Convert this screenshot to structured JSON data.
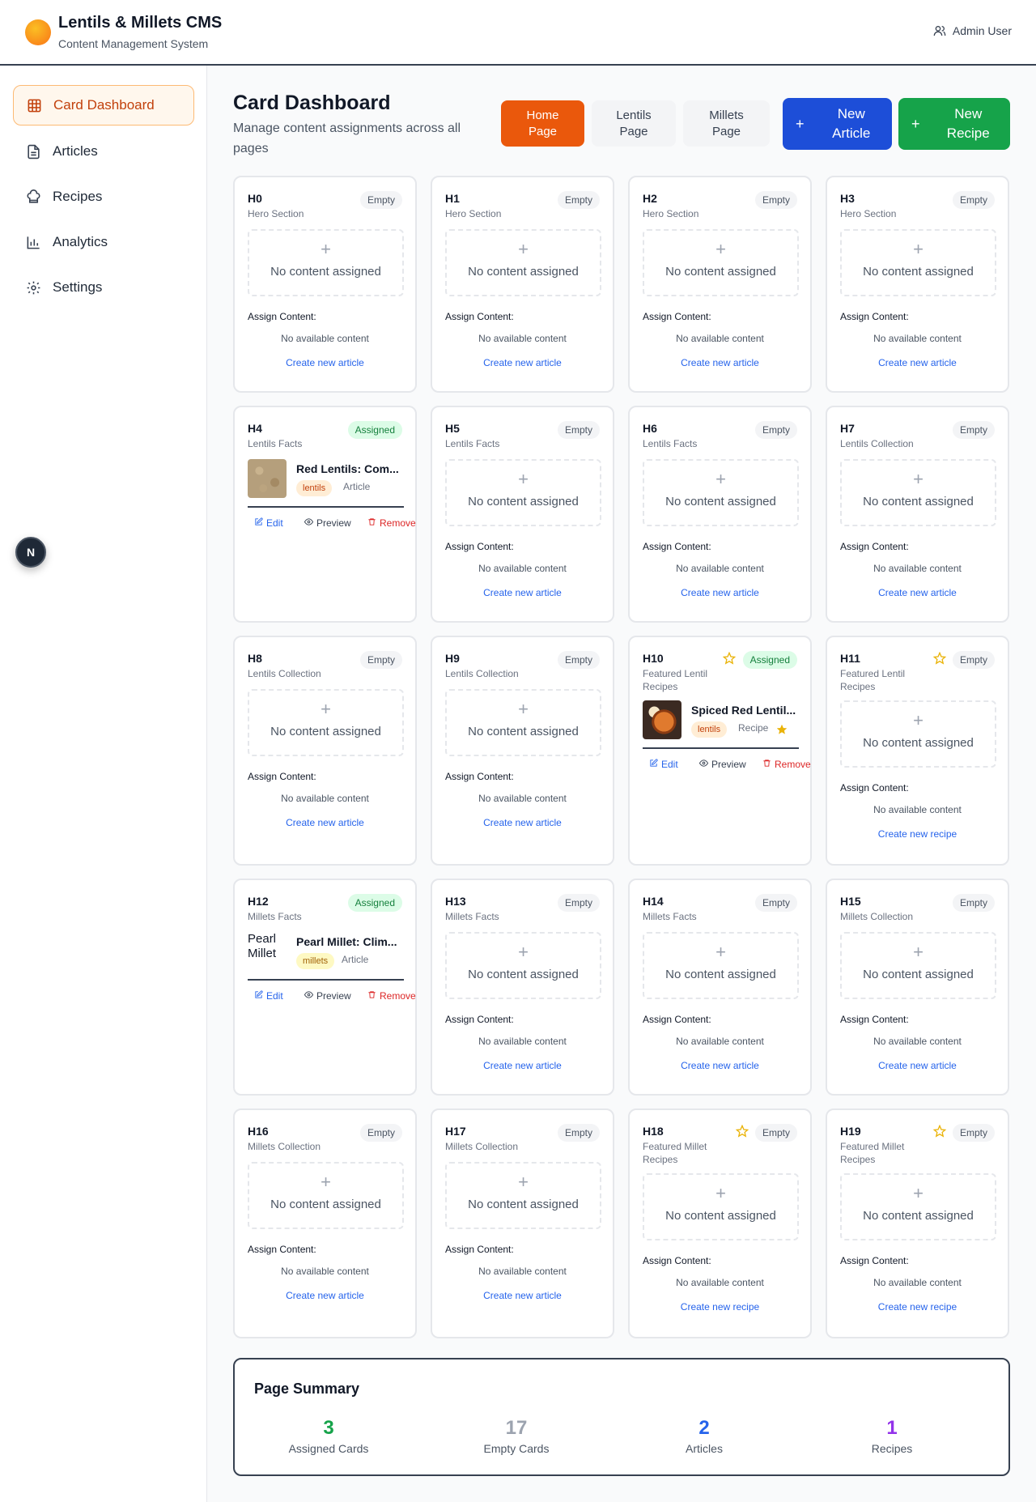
{
  "header": {
    "title": "Lentils & Millets CMS",
    "subtitle": "Content Management System",
    "user": "Admin User"
  },
  "sidebar": {
    "items": [
      {
        "label": "Card Dashboard",
        "icon": "grid-icon"
      },
      {
        "label": "Articles",
        "icon": "file-text-icon"
      },
      {
        "label": "Recipes",
        "icon": "chef-hat-icon"
      },
      {
        "label": "Analytics",
        "icon": "bar-chart-icon"
      },
      {
        "label": "Settings",
        "icon": "gear-icon"
      }
    ],
    "badge": "N"
  },
  "main": {
    "title": "Card Dashboard",
    "description": "Manage content assignments across all pages",
    "tabs": [
      {
        "label": "Home Page",
        "active": true
      },
      {
        "label": "Lentils Page",
        "active": false
      },
      {
        "label": "Millets Page",
        "active": false
      }
    ],
    "new_article": "New Article",
    "new_recipe": "New Recipe"
  },
  "common": {
    "empty_badge": "Empty",
    "assigned_badge": "Assigned",
    "dropzone_plus": "+",
    "no_content": "No content assigned",
    "assign_label": "Assign Content:",
    "no_available": "No available content",
    "edit": "Edit",
    "preview": "Preview",
    "remove": "Remove",
    "plus": "+"
  },
  "cards": [
    {
      "id": "H0",
      "type": "Hero Section",
      "status": "Empty",
      "featured": false,
      "create": "Create new article"
    },
    {
      "id": "H1",
      "type": "Hero Section",
      "status": "Empty",
      "featured": false,
      "create": "Create new article"
    },
    {
      "id": "H2",
      "type": "Hero Section",
      "status": "Empty",
      "featured": false,
      "create": "Create new article"
    },
    {
      "id": "H3",
      "type": "Hero Section",
      "status": "Empty",
      "featured": false,
      "create": "Create new article"
    },
    {
      "id": "H4",
      "type": "Lentils Facts",
      "status": "Assigned",
      "featured": false,
      "content": {
        "title": "Red Lentils: Com...",
        "tag": "lentils",
        "kind": "Article",
        "thumb": "lentils"
      }
    },
    {
      "id": "H5",
      "type": "Lentils Facts",
      "status": "Empty",
      "featured": false,
      "create": "Create new article"
    },
    {
      "id": "H6",
      "type": "Lentils Facts",
      "status": "Empty",
      "featured": false,
      "create": "Create new article"
    },
    {
      "id": "H7",
      "type": "Lentils Collection",
      "status": "Empty",
      "featured": false,
      "create": "Create new article"
    },
    {
      "id": "H8",
      "type": "Lentils Collection",
      "status": "Empty",
      "featured": false,
      "create": "Create new article"
    },
    {
      "id": "H9",
      "type": "Lentils Collection",
      "status": "Empty",
      "featured": false,
      "create": "Create new article"
    },
    {
      "id": "H10",
      "type": "Featured Lentil Recipes",
      "status": "Assigned",
      "featured": true,
      "content": {
        "title": "Spiced Red Lentil...",
        "tag": "lentils",
        "kind": "Recipe",
        "thumb": "curry",
        "starred": true
      }
    },
    {
      "id": "H11",
      "type": "Featured Lentil Recipes",
      "status": "Empty",
      "featured": true,
      "create": "Create new recipe"
    },
    {
      "id": "H12",
      "type": "Millets Facts",
      "status": "Assigned",
      "featured": false,
      "content": {
        "title": "Pearl Millet: Clim...",
        "tag": "millets",
        "kind": "Article",
        "thumb": "broken",
        "alt": "Pearl Millet"
      }
    },
    {
      "id": "H13",
      "type": "Millets Facts",
      "status": "Empty",
      "featured": false,
      "create": "Create new article"
    },
    {
      "id": "H14",
      "type": "Millets Facts",
      "status": "Empty",
      "featured": false,
      "create": "Create new article"
    },
    {
      "id": "H15",
      "type": "Millets Collection",
      "status": "Empty",
      "featured": false,
      "create": "Create new article"
    },
    {
      "id": "H16",
      "type": "Millets Collection",
      "status": "Empty",
      "featured": false,
      "create": "Create new article"
    },
    {
      "id": "H17",
      "type": "Millets Collection",
      "status": "Empty",
      "featured": false,
      "create": "Create new article"
    },
    {
      "id": "H18",
      "type": "Featured Millet Recipes",
      "status": "Empty",
      "featured": true,
      "create": "Create new recipe"
    },
    {
      "id": "H19",
      "type": "Featured Millet Recipes",
      "status": "Empty",
      "featured": true,
      "create": "Create new recipe"
    }
  ],
  "summary": {
    "title": "Page Summary",
    "stats": [
      {
        "value": "3",
        "label": "Assigned Cards",
        "color": "#16a34a"
      },
      {
        "value": "17",
        "label": "Empty Cards",
        "color": "#9ca3af"
      },
      {
        "value": "2",
        "label": "Articles",
        "color": "#2563eb"
      },
      {
        "value": "1",
        "label": "Recipes",
        "color": "#9333ea"
      }
    ]
  },
  "colors": {
    "accent": "#ea580c",
    "new_article": "#1d4ed8",
    "new_recipe": "#16a34a"
  }
}
